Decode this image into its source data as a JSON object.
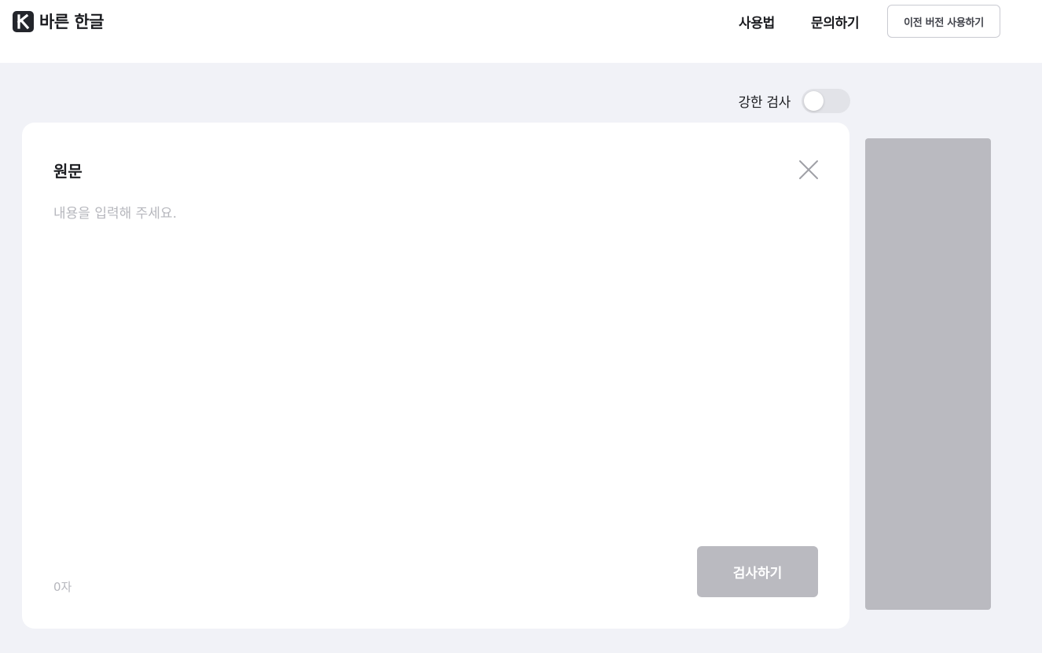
{
  "header": {
    "logo_letter": "K",
    "logo_text": "바른 한글",
    "nav": {
      "usage": "사용법",
      "inquiry": "문의하기"
    },
    "old_version_label": "이전 버전 사용하기"
  },
  "strict_check": {
    "label": "강한 검사",
    "enabled": false
  },
  "editor": {
    "title": "원문",
    "placeholder": "내용을 입력해 주세요.",
    "value": "",
    "char_count": "0자",
    "check_button_label": "검사하기"
  },
  "icons": {
    "logo": "logo-k-icon",
    "clear": "close-icon"
  },
  "colors": {
    "page_background": "#f1f2f7",
    "logo_mark": "#23252b",
    "check_button_disabled": "#babac0",
    "side_panel": "#babac0",
    "toggle_off": "#e2e3e8",
    "placeholder_text": "#b6b7bd"
  }
}
